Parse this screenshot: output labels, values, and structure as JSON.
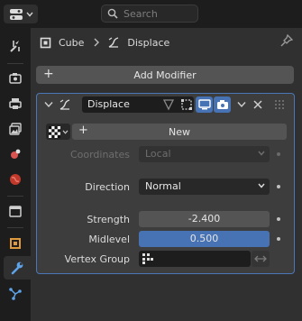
{
  "header": {
    "search_placeholder": "Search",
    "editor_type_icon": "properties-editor-icon"
  },
  "sidebar": {
    "tabs": [
      {
        "name": "tool",
        "icon": "wrench-screwdriver-icon"
      },
      {
        "name": "render",
        "icon": "render-camera-icon"
      },
      {
        "name": "output",
        "icon": "printer-icon"
      },
      {
        "name": "view-layer",
        "icon": "images-icon"
      },
      {
        "name": "scene",
        "icon": "scene-icon"
      },
      {
        "name": "world",
        "icon": "world-globe-icon"
      },
      {
        "name": "collection",
        "icon": "collection-box-icon"
      },
      {
        "name": "object",
        "icon": "object-cube-icon"
      },
      {
        "name": "modifiers",
        "icon": "wrench-icon",
        "active": true
      },
      {
        "name": "particles",
        "icon": "particles-icon"
      }
    ]
  },
  "breadcrumb": {
    "object": "Cube",
    "modifier": "Displace"
  },
  "toolbar": {
    "add_modifier_label": "Add Modifier"
  },
  "modifier": {
    "name": "Displace",
    "texture_new_label": "New",
    "coordinates_label": "Coordinates",
    "coordinates_value": "Local",
    "direction_label": "Direction",
    "direction_value": "Normal",
    "strength_label": "Strength",
    "strength_value": "-2.400",
    "midlevel_label": "Midlevel",
    "midlevel_value": "0.500",
    "midlevel_fraction": 1.0,
    "vertex_group_label": "Vertex Group",
    "vertex_group_value": ""
  },
  "colors": {
    "accent": "#4772b3",
    "panel_outline": "#4b77b8",
    "modifier_tab_icon": "#5ea2e8"
  }
}
